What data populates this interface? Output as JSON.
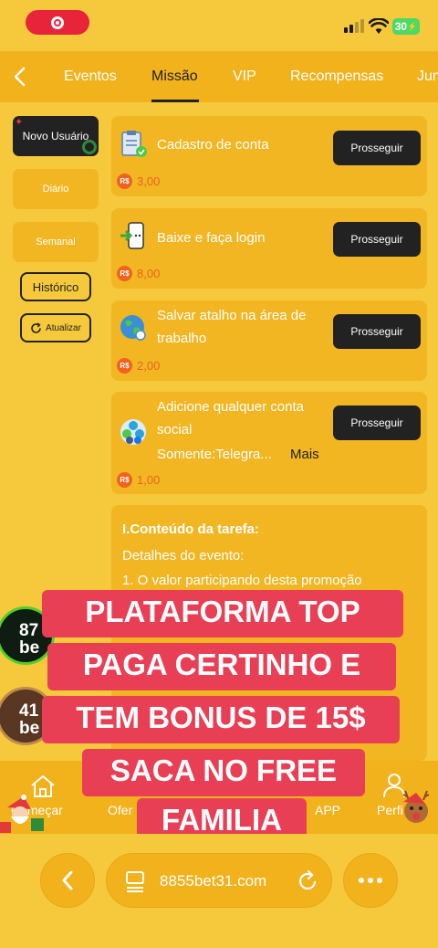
{
  "status_bar": {
    "battery": "30"
  },
  "tabs": [
    "Eventos",
    "Missão",
    "VIP",
    "Recompensas",
    "Jun"
  ],
  "sidebar": {
    "new_user": "Novo Usuário",
    "daily": "Diário",
    "weekly": "Semanal",
    "history": "Histórico",
    "refresh": "Atualizar"
  },
  "tasks": [
    {
      "icon": "clipboard-icon",
      "title": "Cadastro de conta",
      "button": "Prosseguir",
      "currency": "R$",
      "reward": "3,00"
    },
    {
      "icon": "phone-login-icon",
      "title": "Baixe e faça login",
      "button": "Prosseguir",
      "currency": "R$",
      "reward": "8,00"
    },
    {
      "icon": "globe-icon",
      "title": "Salvar atalho na área de trabalho",
      "button": "Prosseguir",
      "currency": "R$",
      "reward": "2,00"
    },
    {
      "icon": "social-apps-icon",
      "title": "Adicione qualquer conta social",
      "subtitle": "Somente:Telegra...",
      "more": "Mais",
      "button": "Prosseguir",
      "currency": "R$",
      "reward": "1,00"
    }
  ],
  "info": {
    "heading": "I.Conteúdo da tarefa:",
    "line1": "Detalhes do evento:",
    "line2": "1. O valor participando desta promoção"
  },
  "floating": {
    "circle1": "87 be",
    "circle2": "41 be"
  },
  "overlay": [
    "PLATAFORMA TOP",
    "PAGA CERTINHO E",
    "TEM BONUS DE 15$",
    "SACA NO FREE",
    "FAMILIA"
  ],
  "bottom_nav": {
    "start": "Começar",
    "offers": "Ofer",
    "app": "APP",
    "profile": "Perfi"
  },
  "browser": {
    "url": "8855bet31.com"
  },
  "colors": {
    "background": "#f6c83c",
    "bar": "#f1b21c",
    "card": "#f2b623",
    "button": "#222222",
    "reward": "#e5651c",
    "overlay": "#e93f55"
  }
}
